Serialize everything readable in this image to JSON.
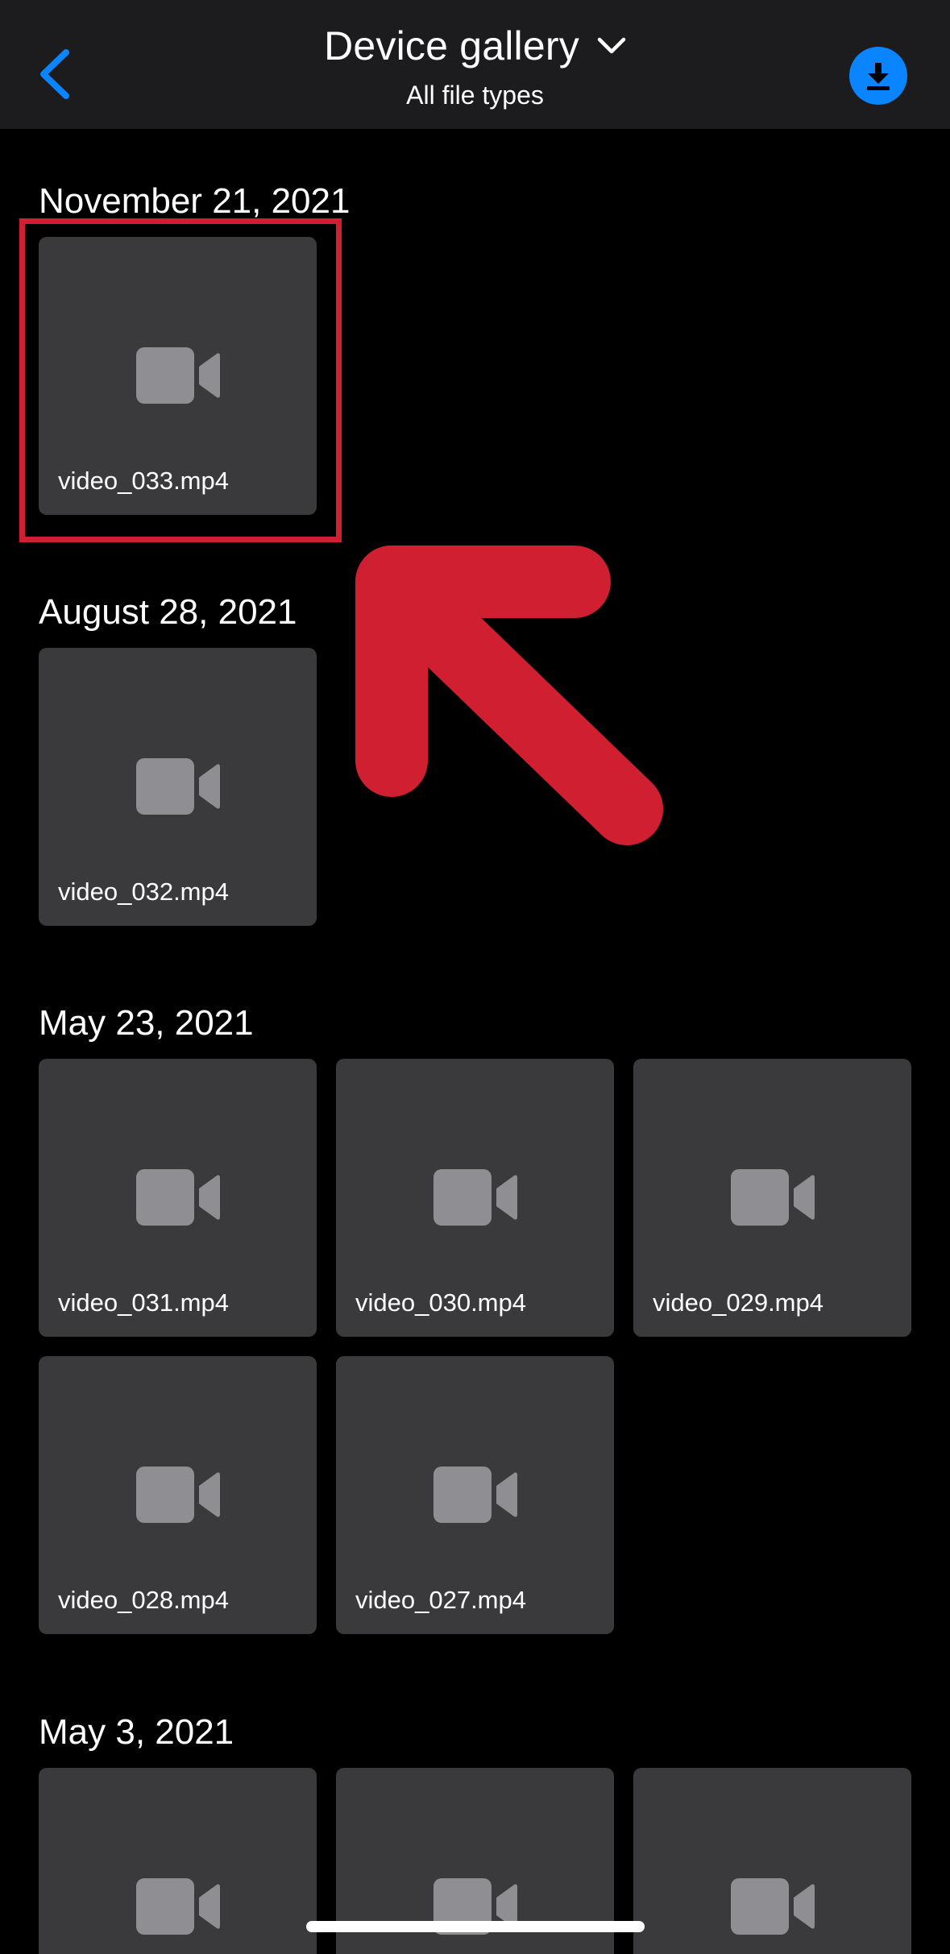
{
  "header": {
    "title": "Device gallery",
    "subtitle": "All file types",
    "back_icon": "chevron-left-icon",
    "dropdown_icon": "chevron-down-icon",
    "download_icon": "download-icon",
    "accent_color": "#0a84ff"
  },
  "sections": [
    {
      "date": "November 21, 2021",
      "files": [
        "video_033.mp4"
      ]
    },
    {
      "date": "August 28, 2021",
      "files": [
        "video_032.mp4"
      ]
    },
    {
      "date": "May 23, 2021",
      "files": [
        "video_031.mp4",
        "video_030.mp4",
        "video_029.mp4",
        "video_028.mp4",
        "video_027.mp4"
      ]
    },
    {
      "date": "May 3, 2021",
      "files": [
        "",
        "",
        ""
      ]
    }
  ],
  "tile_icon": "video-camera-icon",
  "annotation": {
    "highlight_color": "#d01f30",
    "arrow_icon": "arrow-up-left-icon"
  }
}
